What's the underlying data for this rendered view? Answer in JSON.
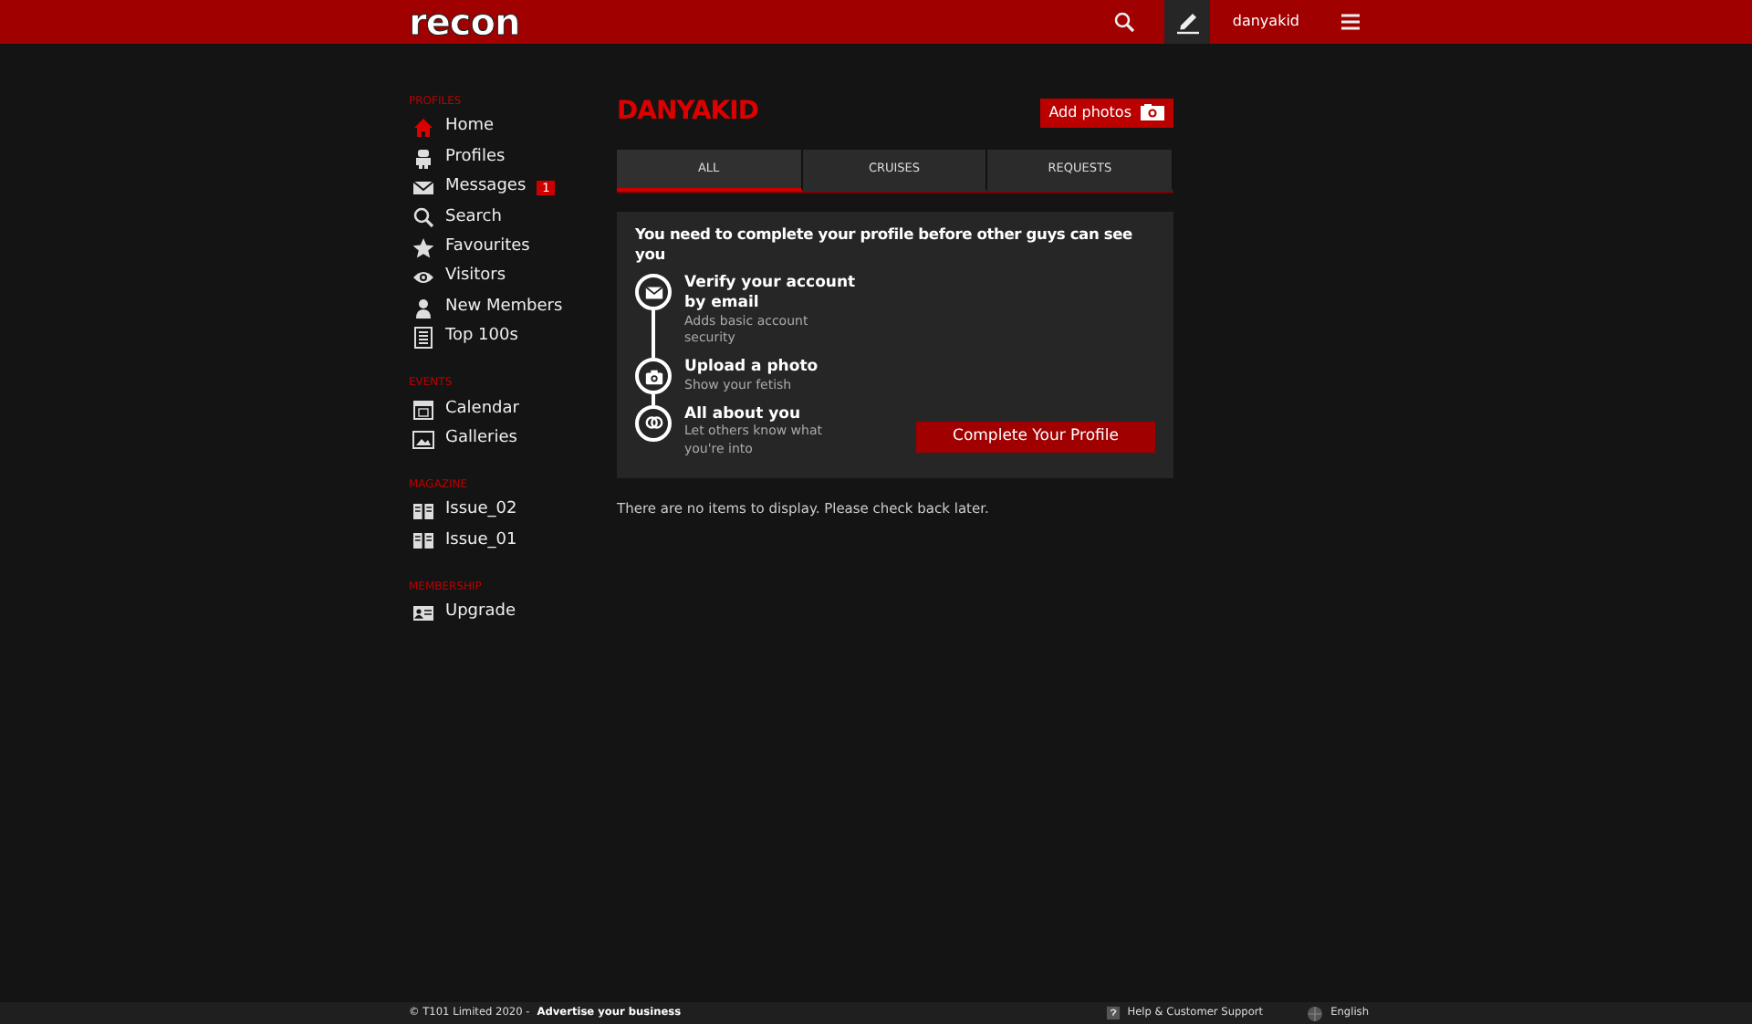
{
  "header": {
    "logo": "recon",
    "username": "danyakid"
  },
  "sidebar": [
    {
      "heading": "PROFILES",
      "items": [
        {
          "label": "Home",
          "selected": true
        },
        {
          "label": "Profiles",
          "selected": false
        },
        {
          "label": "Messages",
          "selected": false,
          "badge": "1"
        },
        {
          "label": "Search",
          "selected": false
        },
        {
          "label": "Favourites",
          "selected": false
        },
        {
          "label": "Visitors",
          "selected": false
        },
        {
          "label": "New Members",
          "selected": false
        },
        {
          "label": "Top 100s",
          "selected": false
        }
      ]
    },
    {
      "heading": "EVENTS",
      "items": [
        {
          "label": "Calendar",
          "selected": false
        },
        {
          "label": "Galleries",
          "selected": false
        }
      ]
    },
    {
      "heading": "MAGAZINE",
      "items": [
        {
          "label": "Issue_02",
          "selected": false
        },
        {
          "label": "Issue_01",
          "selected": false
        }
      ]
    },
    {
      "heading": "MEMBERSHIP",
      "items": [
        {
          "label": "Upgrade",
          "selected": false
        }
      ]
    }
  ],
  "profile": {
    "name": "DANYAKID",
    "add_photos": "Add photos"
  },
  "tabs": [
    {
      "label": "ALL",
      "selected": true
    },
    {
      "label": "CRUISES",
      "selected": false
    },
    {
      "label": "REQUESTS",
      "selected": false
    }
  ],
  "completion": {
    "title": "You need to complete your profile before other guys can see you",
    "steps": [
      {
        "title": "Verify your account by email",
        "subtitle": "Adds basic account security"
      },
      {
        "title": "Upload a photo",
        "subtitle": "Show your fetish"
      },
      {
        "title": "All about you",
        "subtitle": "Let others know what you're into"
      }
    ],
    "button": "Complete Your Profile"
  },
  "empty_message": "There are no items to display. Please check back later.",
  "footer": {
    "copyright": "© T101 Limited 2020 -",
    "link": "Advertise your business",
    "help": "Help & Customer Support",
    "language": "English"
  }
}
